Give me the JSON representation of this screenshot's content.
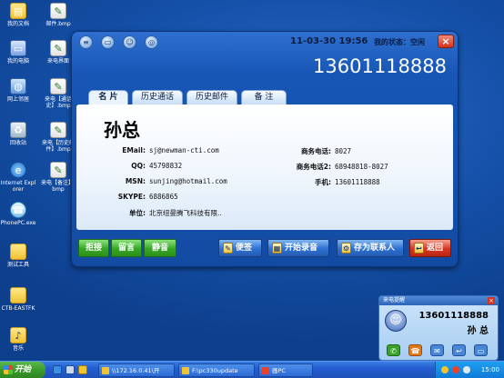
{
  "desktop": {
    "icons": [
      {
        "label": "我的文档",
        "icon": "folder-icon"
      },
      {
        "label": "邮件.bmp",
        "icon": "bmp-file-icon"
      },
      {
        "label": "我的电脑",
        "icon": "computer-icon"
      },
      {
        "label": "来电界面",
        "icon": "bmp-file-icon"
      },
      {
        "label": "网上邻居",
        "icon": "network-icon"
      },
      {
        "label": "来电【通话史】.bmp",
        "icon": "bmp-file-icon"
      },
      {
        "label": "回收站",
        "icon": "recycle-bin-icon"
      },
      {
        "label": "来电【历史邮件】.bmp",
        "icon": "bmp-file-icon"
      },
      {
        "label": "Internet Explorer",
        "icon": "internet-explorer-icon"
      },
      {
        "label": "来电【备注】.bmp",
        "icon": "bmp-file-icon"
      },
      {
        "label": "PhonePC.exe",
        "icon": "phonepc-app-icon"
      },
      {
        "label": "测试工具",
        "icon": "folder-icon"
      },
      {
        "label": "CTB-EASTFK",
        "icon": "folder-icon"
      },
      {
        "label": "音乐",
        "icon": "music-folder-icon"
      }
    ]
  },
  "window": {
    "toolbar_icons": [
      "menu-icon",
      "screen-icon",
      "user-icon",
      "globe-icon"
    ],
    "datetime": "11-03-30 19:56",
    "status": "我的状态：空闲",
    "close_label": "×",
    "phone_number": "13601118888",
    "tabs": [
      "名 片",
      "历史通话",
      "历史邮件",
      "备 注"
    ],
    "card": {
      "name": "孙总",
      "email_label": "EMail:",
      "email": "sj@newman-cti.com",
      "qq_label": "QQ:",
      "qq": "45798832",
      "msn_label": "MSN:",
      "msn": "sunjing@hotmail.com",
      "skype_label": "SKYPE:",
      "skype": "6886865",
      "company_label": "单位:",
      "company": "北京纽曼腾飞科技有限..",
      "work_phone_label": "商务电话:",
      "work_phone": "8027",
      "work_phone2_label": "商务电话2:",
      "work_phone2": "68948818-8027",
      "mobile_label": "手机:",
      "mobile": "13601118888"
    },
    "buttons": {
      "reject": "拒接",
      "voicemail": "留言",
      "mute": "静音",
      "note": "便签",
      "record": "开始录音",
      "save_contact": "存为联系人",
      "back": "返回"
    }
  },
  "popup": {
    "title": "来电提醒",
    "number": "13601118888",
    "name": "孙 总",
    "actions": [
      "answer-icon",
      "hangup-icon",
      "message-icon",
      "back-icon",
      "screen-icon"
    ]
  },
  "taskbar": {
    "start_label": "开始",
    "tasks": [
      "\\\\172.16.0.41\\开",
      "F:\\pc330update",
      "画PC"
    ],
    "clock": "15:00"
  },
  "colors": {
    "desktop": "#1450a8",
    "window": "#1756b5",
    "green_button": "#35a623",
    "blue_button": "#2f6fd0",
    "red_button": "#d9341f"
  }
}
